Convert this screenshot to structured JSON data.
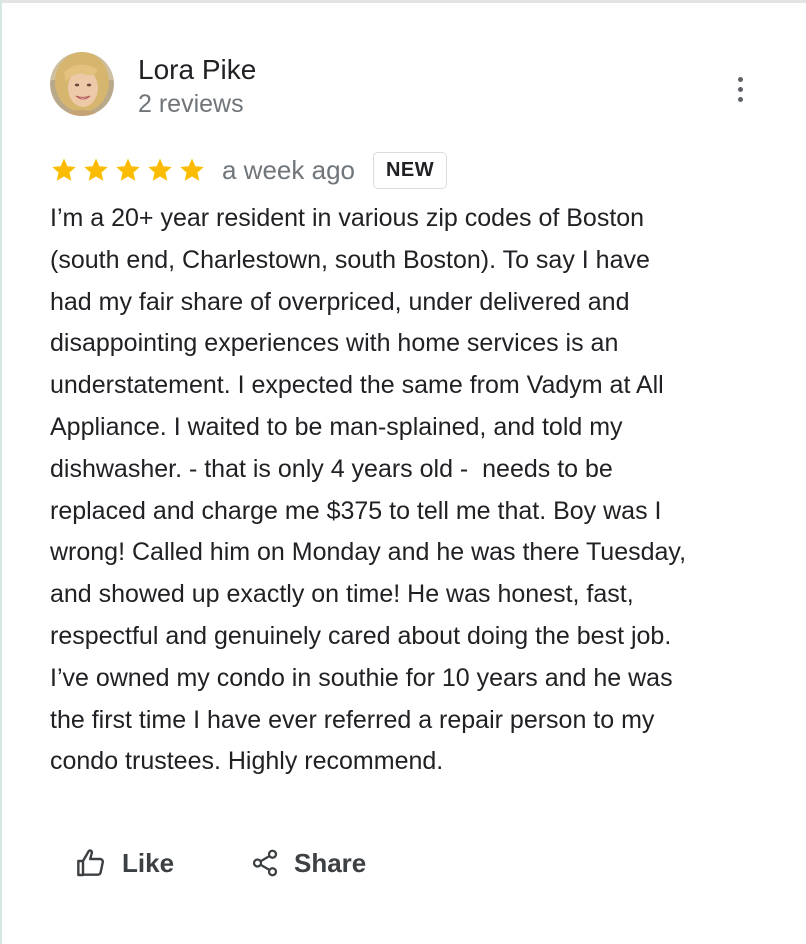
{
  "review": {
    "author": "Lora Pike",
    "review_count": "2 reviews",
    "rating": 5,
    "rating_max": 5,
    "time_ago": "a week ago",
    "badge": "NEW",
    "text": "I’m a 20+ year resident in various zip codes of Boston\n(south end, Charlestown, south Boston). To say I have\nhad my fair share of overpriced, under delivered and\ndisappointing experiences with home services is an\nunderstatement. I expected the same from Vadym at All\nAppliance. I waited to be man-splained, and told my\ndishwasher. - that is only 4 years old -  needs to be\nreplaced and charge me $375 to tell me that. Boy was I\nwrong! Called him on Monday and he was there Tuesday,\nand showed up exactly on time! He was honest, fast,\nrespectful and genuinely cared about doing the best job.\nI’ve owned my condo in southie for 10 years and he was\nthe first time I have ever referred a repair person to my\ncondo trustees. Highly recommend."
  },
  "actions": {
    "like_label": "Like",
    "share_label": "Share"
  },
  "icons": {
    "avatar": "user-photo",
    "more": "more-vert-icon",
    "star": "star-icon",
    "like": "thumb-up-icon",
    "share": "share-icon"
  },
  "colors": {
    "star": "#fbbc04",
    "text": "#202124",
    "secondary": "#70757a",
    "badge_border": "#dadce0"
  }
}
